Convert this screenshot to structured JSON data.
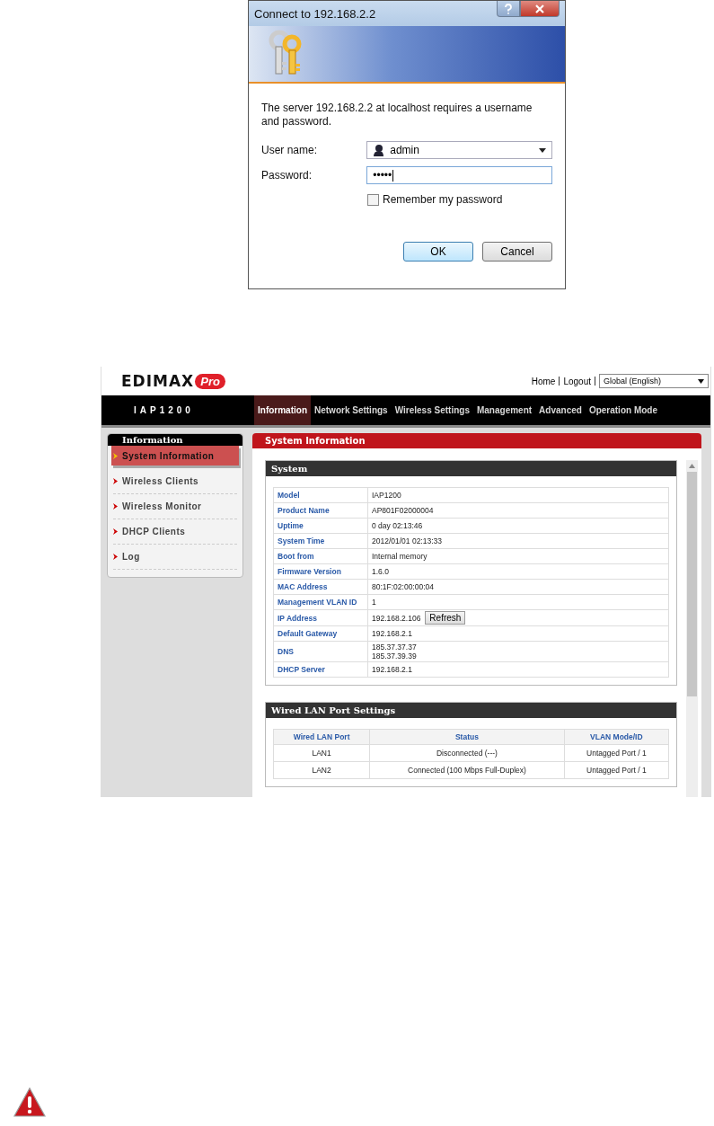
{
  "login_dialog": {
    "title": "Connect to 192.168.2.2",
    "message": "The server 192.168.2.2 at localhost requires a username and password.",
    "fields": [
      {
        "kind": "dropdown",
        "label": "User name:",
        "value": "admin"
      },
      {
        "kind": "password",
        "label": "Password:",
        "value": "•••••"
      }
    ],
    "remember": {
      "label": "Remember my password",
      "checked": false
    },
    "buttons": [
      {
        "label": "OK",
        "default": true
      },
      {
        "label": "Cancel",
        "default": false
      }
    ]
  },
  "web_admin": {
    "logo": {
      "brand": "EDIMAX",
      "badge": "Pro"
    },
    "header_links": [
      "Home",
      "Logout"
    ],
    "language": "Global (English)",
    "model": "IAP1200",
    "nav_tabs": [
      {
        "label": "Information",
        "selected": true
      },
      {
        "label": "Network Settings",
        "selected": false
      },
      {
        "label": "Wireless Settings",
        "selected": false
      },
      {
        "label": "Management",
        "selected": false
      },
      {
        "label": "Advanced",
        "selected": false
      },
      {
        "label": "Operation Mode",
        "selected": false
      }
    ],
    "sidebar": {
      "title": "Information",
      "items": [
        {
          "label": "System Information",
          "selected": true
        },
        {
          "label": "Wireless Clients",
          "selected": false
        },
        {
          "label": "Wireless Monitor",
          "selected": false
        },
        {
          "label": "DHCP Clients",
          "selected": false
        },
        {
          "label": "Log",
          "selected": false
        }
      ]
    },
    "page_title": "System Information",
    "system": {
      "title": "System",
      "rows": [
        {
          "label": "Model",
          "values": [
            "IAP1200"
          ]
        },
        {
          "label": "Product Name",
          "values": [
            "AP801F02000004"
          ]
        },
        {
          "label": "Uptime",
          "values": [
            "0 day 02:13:46"
          ]
        },
        {
          "label": "System Time",
          "values": [
            "2012/01/01 02:13:33"
          ]
        },
        {
          "label": "Boot from",
          "values": [
            "Internal memory"
          ]
        },
        {
          "label": "Firmware Version",
          "values": [
            "1.6.0"
          ]
        },
        {
          "label": "MAC Address",
          "values": [
            "80:1F:02:00:00:04"
          ]
        },
        {
          "label": "Management VLAN ID",
          "values": [
            "1"
          ]
        },
        {
          "label": "IP Address",
          "values": [
            "192.168.2.106"
          ],
          "button": "Refresh"
        },
        {
          "label": "Default Gateway",
          "values": [
            "192.168.2.1"
          ]
        },
        {
          "label": "DNS",
          "values": [
            "185.37.37.37",
            "185.37.39.39"
          ]
        },
        {
          "label": "DHCP Server",
          "values": [
            "192.168.2.1"
          ]
        }
      ]
    },
    "wired_lan": {
      "title": "Wired LAN Port Settings",
      "columns": [
        "Wired LAN Port",
        "Status",
        "VLAN Mode/ID"
      ],
      "rows": [
        [
          "LAN1",
          "Disconnected (---)",
          "Untagged Port  /  1"
        ],
        [
          "LAN2",
          "Connected (100 Mbps Full-Duplex)",
          "Untagged Port  /  1"
        ]
      ]
    }
  }
}
